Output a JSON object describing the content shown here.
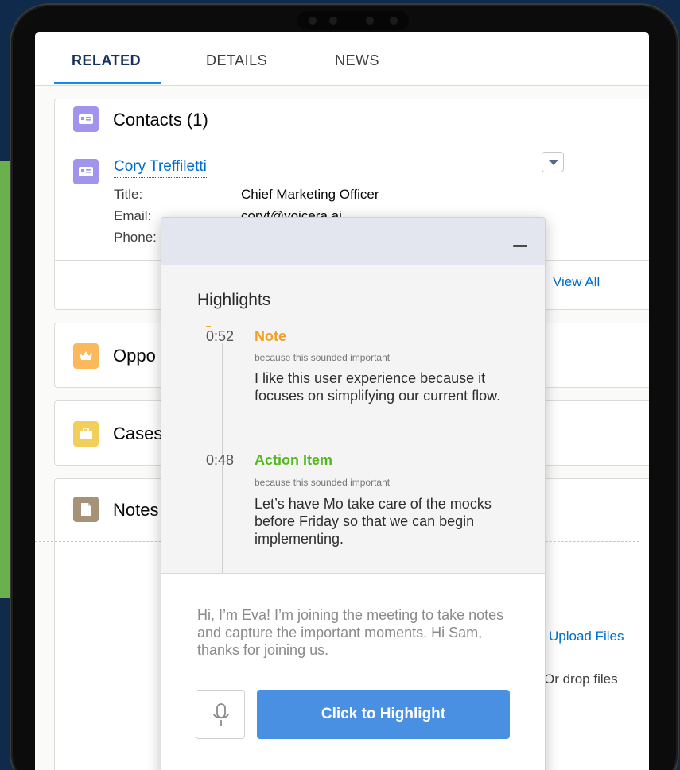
{
  "tabs": [
    {
      "label": "RELATED"
    },
    {
      "label": "DETAILS"
    },
    {
      "label": "NEWS"
    }
  ],
  "contacts": {
    "title": "Contacts (1)",
    "contact_name": "Cory Treffiletti",
    "fields": [
      {
        "label": "Title:",
        "value": "Chief Marketing Officer"
      },
      {
        "label": "Email:",
        "value": "coryt@voicera.ai"
      },
      {
        "label": "Phone:",
        "value": ""
      }
    ],
    "view_all": "View All"
  },
  "opportunities": {
    "title": "Oppo"
  },
  "cases": {
    "title": "Cases"
  },
  "notes": {
    "title": "Notes",
    "upload_label": "Upload Files",
    "drop_label": "Or drop files"
  },
  "highlights": {
    "title": "Highlights",
    "items": [
      {
        "time": "0:52",
        "type": "Note",
        "reason": "because this sounded important",
        "text": "I like this user experience because it focuses on simplifying our current flow."
      },
      {
        "time": "0:48",
        "type": "Action Item",
        "reason": "because this sounded important",
        "text": "Let’s have Mo take care of the mocks before Friday so that we can begin implementing."
      }
    ],
    "assistant_message": "Hi, I’m Eva! I’m joining the meeting to take notes and capture the important moments. Hi Sam, thanks for joining us.",
    "highlight_button": "Click to Highlight"
  },
  "icons": {
    "contact": "contact-card-icon",
    "opportunity": "crown-icon",
    "case": "briefcase-icon",
    "note": "note-icon",
    "mic": "microphone-icon",
    "minimize": "minimize-icon",
    "menu": "chevron-down-icon"
  },
  "colors": {
    "accent": "#4a90e2",
    "link": "#006dcc",
    "note": "#f0a024",
    "action_item": "#53b71f"
  }
}
